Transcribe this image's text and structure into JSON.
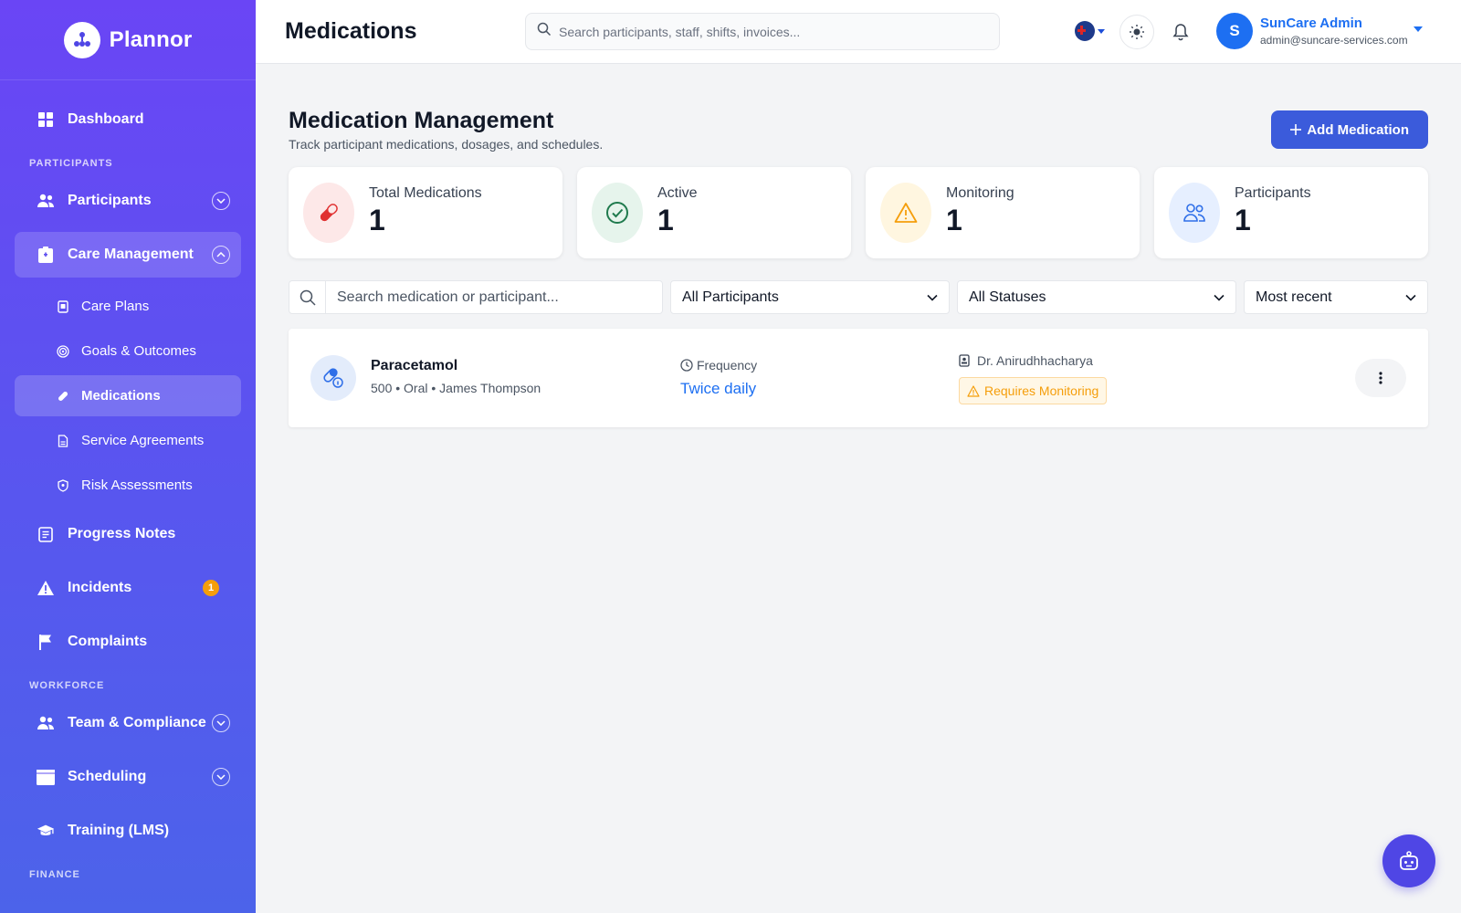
{
  "sidebar": {
    "brand": "Plannor",
    "dashboard": "Dashboard",
    "sections": {
      "participants": "PARTICIPANTS",
      "workforce": "WORKFORCE",
      "finance": "FINANCE"
    },
    "items": {
      "participants": "Participants",
      "care_management": "Care Management",
      "care_plans": "Care Plans",
      "goals": "Goals & Outcomes",
      "medications": "Medications",
      "service_agreements": "Service Agreements",
      "risk_assessments": "Risk Assessments",
      "progress_notes": "Progress Notes",
      "incidents": "Incidents",
      "incidents_badge": "1",
      "complaints": "Complaints",
      "team": "Team & Compliance",
      "scheduling": "Scheduling",
      "training": "Training (LMS)"
    }
  },
  "topbar": {
    "title": "Medications",
    "search_placeholder": "Search participants, staff, shifts, invoices...",
    "user": {
      "initial": "S",
      "name": "SunCare Admin",
      "email": "admin@suncare-services.com"
    }
  },
  "page": {
    "title": "Medication Management",
    "subtitle": "Track participant medications, dosages, and schedules.",
    "add_button": "Add Medication"
  },
  "stats": [
    {
      "label": "Total Medications",
      "value": "1",
      "icon": "pill-icon"
    },
    {
      "label": "Active",
      "value": "1",
      "icon": "check-circle-icon"
    },
    {
      "label": "Monitoring",
      "value": "1",
      "icon": "warning-icon"
    },
    {
      "label": "Participants",
      "value": "1",
      "icon": "users-icon"
    }
  ],
  "filters": {
    "search_placeholder": "Search medication or participant...",
    "participant": "All Participants",
    "status": "All Statuses",
    "sort": "Most recent"
  },
  "medications": [
    {
      "name": "Paracetamol",
      "meta": "500 • Oral • James Thompson",
      "frequency_label": "Frequency",
      "frequency": "Twice daily",
      "doctor": "Dr. Anirudhhacharya",
      "status": "Requires Monitoring"
    }
  ],
  "colors": {
    "accent": "#3b5bdb",
    "link": "#1d6ff2",
    "warning": "#f59e0b",
    "sidebar_top": "#6a45f5",
    "sidebar_bottom": "#4c63ea"
  }
}
